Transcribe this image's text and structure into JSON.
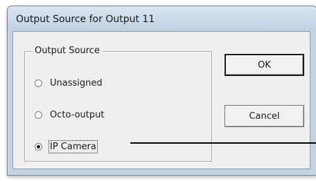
{
  "window": {
    "title": "Output Source for Output 11"
  },
  "group": {
    "label": "Output Source",
    "options": [
      {
        "label": "Unassigned",
        "selected": false
      },
      {
        "label": "Octo-output",
        "selected": false
      },
      {
        "label": "IP Camera",
        "selected": true
      }
    ]
  },
  "buttons": {
    "ok_label": "OK",
    "cancel_label": "Cancel"
  },
  "colors": {
    "title_bar": "#c3d3e4",
    "client_bg": "#efefef"
  }
}
